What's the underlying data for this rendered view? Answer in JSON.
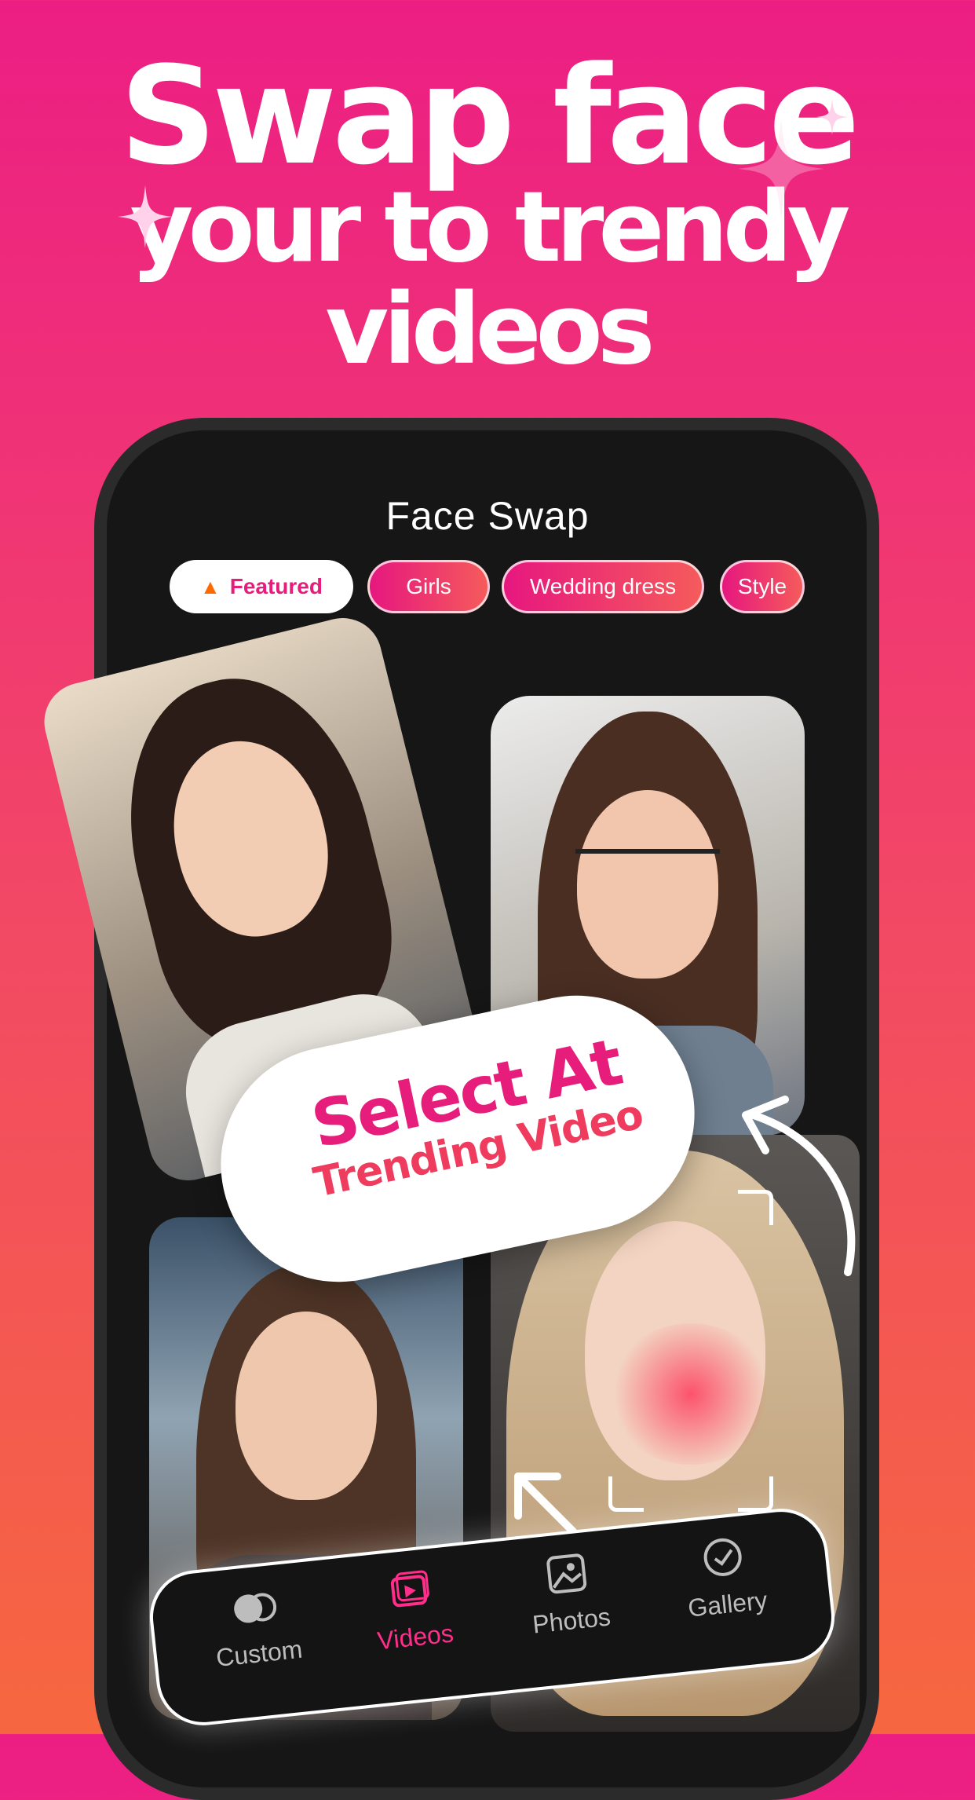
{
  "headline": {
    "line1": "Swap face",
    "line2": "your to trendy",
    "line3": "videos"
  },
  "app": {
    "title": "Face Swap",
    "chips": [
      {
        "label": "Featured",
        "icon": "flame-icon",
        "active": true
      },
      {
        "label": "Girls",
        "active": false
      },
      {
        "label": "Wedding dress",
        "active": false
      },
      {
        "label": "Style",
        "active": false
      }
    ]
  },
  "callout": {
    "line1": "Select At",
    "line2": "Trending Video"
  },
  "nav": {
    "items": [
      {
        "label": "Custom",
        "icon": "faces-icon",
        "active": false
      },
      {
        "label": "Videos",
        "icon": "video-play-icon",
        "active": true
      },
      {
        "label": "Photos",
        "icon": "image-icon",
        "active": false
      },
      {
        "label": "Gallery",
        "icon": "check-circle-icon",
        "active": false
      }
    ]
  },
  "colors": {
    "accent": "#e71d7c",
    "gradient_top": "#ec1e83",
    "gradient_bottom": "#f6673f",
    "phone_bg": "#161616"
  }
}
